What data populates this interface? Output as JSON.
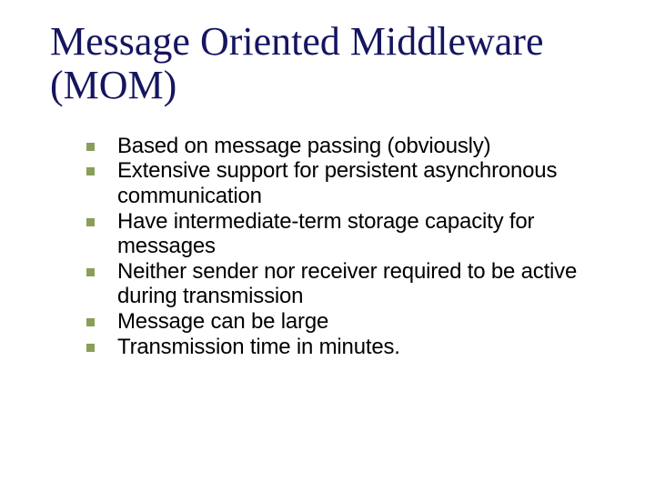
{
  "title": "Message Oriented Middleware (MOM)",
  "bullets": [
    "Based on message passing (obviously)",
    "Extensive support for persistent asynchronous communication",
    "Have intermediate-term storage capacity for messages",
    "Neither sender nor receiver required to be active during transmission",
    "Message can be large",
    "Transmission time in minutes."
  ]
}
